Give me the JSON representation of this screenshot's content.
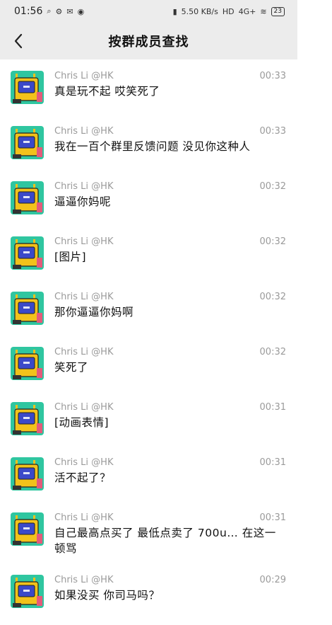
{
  "status_bar": {
    "time": "01:56",
    "left_icons": [
      "search-icon",
      "app-icon",
      "mail-icon",
      "vpn-icon"
    ],
    "right_icons": [
      "vibrate-icon",
      "hd-icon",
      "signal-icon",
      "wifi-icon"
    ],
    "network_speed": "5.50 KB/s",
    "hd_label": "HD",
    "network_type": "4G+",
    "battery": "23"
  },
  "header": {
    "title": "按群成员查找",
    "back_icon": "chevron-left-icon"
  },
  "avatar_colors": {
    "bg": "#2fc6a0",
    "robot": "#f2c21b",
    "screen": "#3b49c9",
    "accent": "#e55a7a"
  },
  "messages": [
    {
      "name": "Chris Li @HK",
      "time": "00:33",
      "text": "真是玩不起 哎笑死了"
    },
    {
      "name": "Chris Li @HK",
      "time": "00:33",
      "text": "我在一百个群里反馈问题 没见你这种人"
    },
    {
      "name": "Chris Li @HK",
      "time": "00:32",
      "text": "逼逼你妈呢"
    },
    {
      "name": "Chris Li @HK",
      "time": "00:32",
      "text": "[图片]"
    },
    {
      "name": "Chris Li @HK",
      "time": "00:32",
      "text": "那你逼逼你妈啊"
    },
    {
      "name": "Chris Li @HK",
      "time": "00:32",
      "text": "笑死了"
    },
    {
      "name": "Chris Li @HK",
      "time": "00:31",
      "text": "[动画表情]"
    },
    {
      "name": "Chris Li @HK",
      "time": "00:31",
      "text": "活不起了？"
    },
    {
      "name": "Chris Li @HK",
      "time": "00:31",
      "text": "自己最高点买了 最低点卖了 700u… 在这一顿骂"
    },
    {
      "name": "Chris Li @HK",
      "time": "00:29",
      "text": "如果没买 你司马吗？"
    }
  ]
}
